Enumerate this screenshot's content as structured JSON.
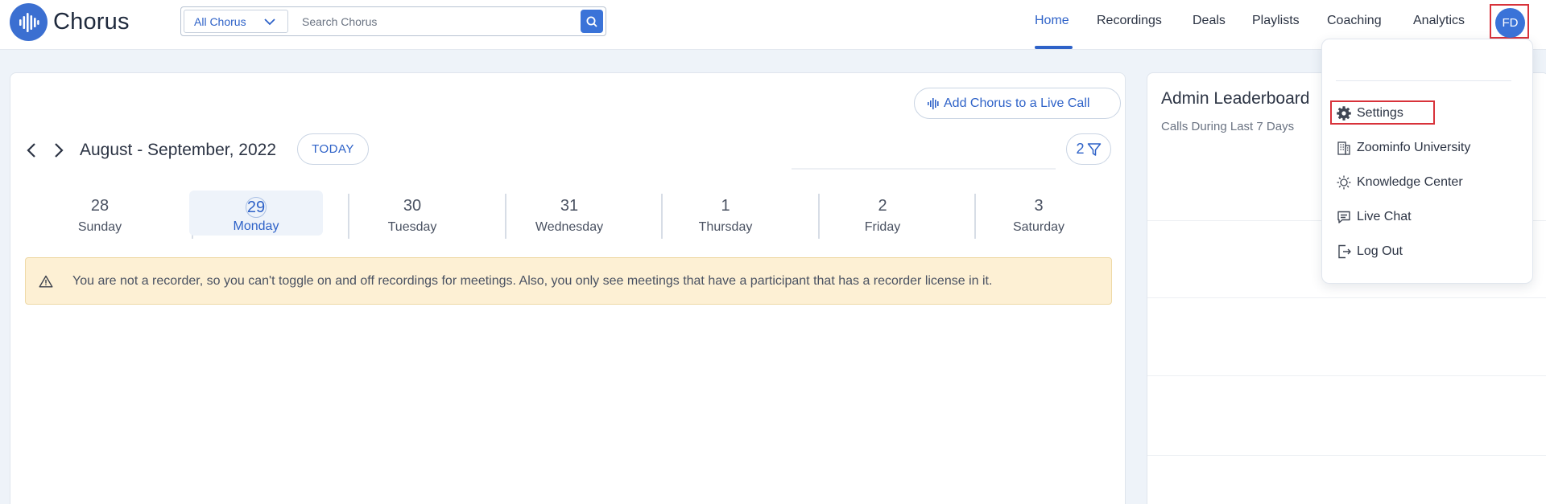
{
  "app": {
    "name": "Chorus"
  },
  "search": {
    "scope": "All Chorus",
    "placeholder": "Search Chorus"
  },
  "nav": [
    "Home",
    "Recordings",
    "Deals",
    "Playlists",
    "Coaching",
    "Analytics"
  ],
  "nav_active": "Home",
  "user": {
    "initials": "FD"
  },
  "calendar": {
    "add_live_call": "Add Chorus to a Live Call",
    "range_title": "August - September, 2022",
    "today_label": "TODAY",
    "filter_count": "2",
    "days": [
      {
        "num": "28",
        "name": "Sunday"
      },
      {
        "num": "29",
        "name": "Monday"
      },
      {
        "num": "30",
        "name": "Tuesday"
      },
      {
        "num": "31",
        "name": "Wednesday"
      },
      {
        "num": "1",
        "name": "Thursday"
      },
      {
        "num": "2",
        "name": "Friday"
      },
      {
        "num": "3",
        "name": "Saturday"
      }
    ],
    "selected_day": "29",
    "warning": "You are not a recorder, so you can't toggle on and off recordings for meetings. Also, you only see meetings that have a participant that has a recorder license in it."
  },
  "leaderboard": {
    "title": "Admin Leaderboard",
    "subtitle": "Calls During Last 7 Days"
  },
  "user_menu": {
    "items": [
      {
        "label": "Settings",
        "icon": "gear-icon"
      },
      {
        "label": "Zoominfo University",
        "icon": "building-icon"
      },
      {
        "label": "Knowledge Center",
        "icon": "lightbulb-icon"
      },
      {
        "label": "Live Chat",
        "icon": "chat-icon"
      },
      {
        "label": "Log Out",
        "icon": "logout-icon"
      }
    ]
  },
  "colors": {
    "accent": "#2e62c8",
    "brand": "#3b6fd1",
    "highlight_box": "#d8323a",
    "warning_bg": "#fdf0d4"
  }
}
